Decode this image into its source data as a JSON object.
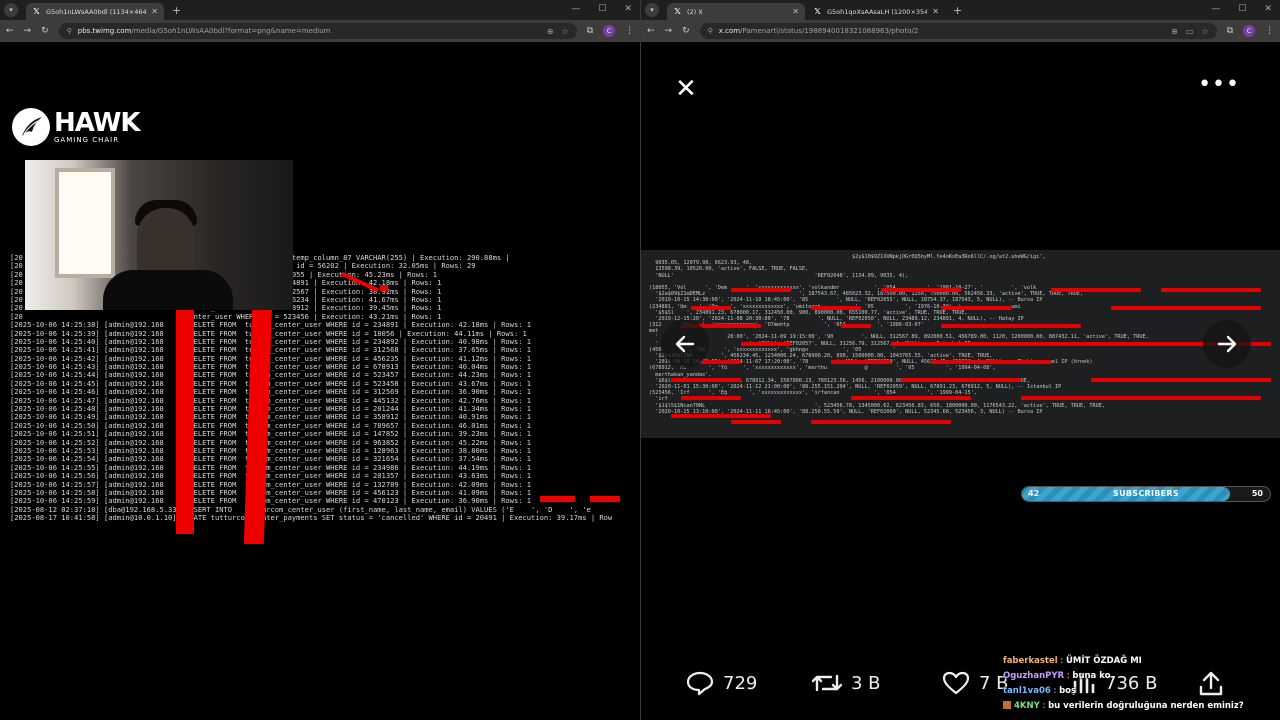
{
  "left_browser": {
    "tab_title": "G5oh1nLWsAA0bdl (1134×464)",
    "url_host": "pbs.twimg.com",
    "url_path": "/media/G5oh1nLWsAA0bdl?format=png&name=medium",
    "profile_initial": "C"
  },
  "right_browser": {
    "tabs": [
      {
        "title": "(2) X",
        "active": true
      },
      {
        "title": "G5oh1qoXsAAsaLH (1200×354)",
        "active": false
      }
    ],
    "url_host": "x.com",
    "url_path": "/Pamenarti/status/1988940018321088963/photo/2",
    "profile_initial": "C"
  },
  "overlay": {
    "brand_name": "HAWK",
    "brand_sub": "GAMING CHAIR"
  },
  "terminal_lines": [
    "[20                                      m_center_user ADD COLUMN temp_column_87 VARCHAR(255) | Execution: 290.88ms |",
    "[20                                      center_transactions WHERE id = 56202 | Execution: 32.05ms | Rows: 29",
    "[20                                      center_user WHERE id = 18055 | Execution: 45.23ms | Rows: 1",
    "[20                                      center_user WHERE id = 234891 | Execution: 42.18ms | Rows: 1",
    "[20                                      center_user WHERE id = 312567 | Execution: 38.92ms | Rows: 1",
    "[20                                      center_user WHERE id = 456234 | Execution: 41.67ms | Rows: 1",
    "[20                                      center_user WHERE id = 678912 | Execution: 39.45ms | Rows: 1",
    "[20                                      center_user WHERE id = 523456 | Execution: 43.21ms | Rows: 1",
    "[2025-10-06 14:25:38] [admin@192.168      DELETE FROM  turcom_center_user WHERE id = 234891 | Execution: 42.18ms | Rows: 1",
    "[2025-10-06 14:25:39] [admin@192.168      DELETE FROM  turcom_center_user WHERE id = 18056 | Execution: 44.11ms | Rows: 1",
    "[2025-10-06 14:25:40] [admin@192.168      DELETE FROM  turcom_center_user WHERE id = 234892 | Execution: 40.98ms | Rows: 1",
    "[2025-10-06 14:25:41] [admin@192.168      DELETE FROM  turcom_center_user WHERE id = 312568 | Execution: 37.65ms | Rows: 1",
    "[2025-10-06 14:25:42] [admin@192.168      DELETE FROM  turcom_center_user WHERE id = 456235 | Execution: 41.12ms | Rows: 1",
    "[2025-10-06 14:25:43] [admin@192.168      DELETE FROM  turcom_center_user WHERE id = 678913 | Execution: 40.04ms | Rows: 1",
    "[2025-10-06 14:25:44] [admin@192.168      DELETE FROM  turcom_center_user WHERE id = 523457 | Execution: 44.23ms | Rows: 1",
    "[2025-10-06 14:25:45] [admin@192.168      DELETE FROM  turcom_center_user WHERE id = 523458 | Execution: 43.67ms | Rows: 1",
    "[2025-10-06 14:25:46] [admin@192.168      DELETE FROM  turcom_center_user WHERE id = 312569 | Execution: 36.90ms | Rows: 1",
    "[2025-10-06 14:25:47] [admin@192.168      DELETE FROM  turcom_center_user WHERE id = 445132 | Execution: 42.76ms | Rows: 1",
    "[2025-10-06 14:25:48] [admin@192.168      DELETE FROM  turcom_center_user WHERE id = 201244 | Execution: 41.34ms | Rows: 1",
    "[2025-10-06 14:25:49] [admin@192.168      DELETE FROM  turcom_center_user WHERE id = 358912 | Execution: 40.91ms | Rows: 1",
    "[2025-10-06 14:25:50] [admin@192.168      DELETE FROM  turcom_center_user WHERE id = 789657 | Execution: 46.01ms | Rows: 1",
    "[2025-10-06 14:25:51] [admin@192.168      DELETE FROM  turcom_center_user WHERE id = 147852 | Execution: 39.23ms | Rows: 1",
    "[2025-10-06 14:25:52] [admin@192.168      DELETE FROM  turcom_center_user WHERE id = 963852 | Execution: 45.22ms | Rows: 1",
    "[2025-10-06 14:25:53] [admin@192.168      DELETE FROM  turcom_center_user WHERE id = 128963 | Execution: 38.80ms | Rows: 1",
    "[2025-10-06 14:25:54] [admin@192.168      DELETE FROM  turcom_center_user WHERE id = 321654 | Execution: 37.54ms | Rows: 1",
    "[2025-10-06 14:25:55] [admin@192.168      DELETE FROM  turcom_center_user WHERE id = 234986 | Execution: 44.19ms | Rows: 1",
    "[2025-10-06 14:25:56] [admin@192.168      DELETE FROM  turcom_center_user WHERE id = 201357 | Execution: 43.63ms | Rows: 1",
    "[2025-10-06 14:25:57] [admin@192.168      DELETE FROM  turcom_center_user WHERE id = 132789 | Execution: 42.09ms | Rows: 1",
    "[2025-10-06 14:25:58] [admin@192.168      DELETE FROM  turcom_center_user WHERE id = 456123 | Execution: 41.09ms | Rows: 1",
    "[2025-10-06 14:25:59] [admin@192.168      DELETE FROM  turcom_center_user WHERE id = 470123 | Execution: 36.90ms | Rows: 1",
    "[2025-08-12 02:37:18] [dba@192.168.5.33] INSERT INTO      turcom_center_user (first_name, last_name, email) VALUES ('E    ', 'D    ', 'e",
    "[2025-08-17 10:41:58] [admin@10.0.1.10] UPDATE tutturcom_center_payments SET status = 'cancelled' WHERE id = 20491 | Execution: 39.17ms | Row"
  ],
  "photo_lines": [
    "                                                                 $2y$10$9Z1XUNpkjOGr0Q5byMl.Ye4oKoEa3Ro6llC/.og/at2.uheWG/igi',",
    "  9035.05, 12079.98, 6623.93, 48,",
    "  13598.39, 10520.00, 'active', FALSE, TRUE, FALSE,",
    "  'NULL'                                             'REF02048', 1134.09, 9035, 4),",
    "",
    "(18055, 'Vol      ', 'Dem      ', 'xxxxxxxxxxxxx', 'volkandmr           ', '054          ', '1981-10-27', '         ', 'volk",
    "  '$2a$09$Z1mDEMLz                              ', 187543.67, 485023.32, 187500.00, 1250, 750000.00, 562456.33, 'active', TRUE, TRUE, TRUE,",
    "  '2019-10-15 14:30:00', '2024-11-10 18:45:00', '85         ', NULL, 'REF02055', NULL, 18754.37, 187543, 5, NULL), -- Bursa IP",
    "(234891, 'Üm    ', 'Öz    ', 'xxxxxxxxxxxxx', 'umitozat           ', '05          ', '1976-10-30', '                umi",
    "  '$5$Sl    ', 234891.23, 678000.17, 312450.00, 980, 890000.00, 655100.77, 'active', TRUE, TRUE, TRUE,",
    "  '2019-12-15:20', '2024-11-08 20:30:00', '78         ', NULL, 'REF02050', NULL, 23489.12, 234891, 4, NULL), -- Hatay IP",
    "(312    , 'Te    ', 'xxxxxxxxxxxxx', 'O7mehtp           ', '054          ', '1986-03-07'",
    "met",
    "  '                      20:00', '2024-11-09 19:15:00', '90         ', NULL, 312567.89, 892000.51, 456789.00, 1120, 1200000.00, 887432.11, 'active', TRUE, TRUE,",
    "  '                             ', 'NULL', 'REF02057', NULL, 31256.79, 312567, 4, NULL), -- Istanbul IP",
    "(456        ', 'Gö      ', 'xxxxxxxxxxxxx', 'gkhngo           ', '05          '",
    "  '$2y$10$l2N4         ', 456234.45, 1234000.24, 678900.20, 890, 1500000.00, 1043765.55, 'active', TRUE, TRUE,",
    "  '2014-09-15 14:20:00', '2024-11-07 17:20:00', '78         ', NULL, 'REF02058', NULL, 45623.45, 456234, 4, NULL), -- Türkiye genel IP (örnek)",
    "(678912, 'Me       ', 'Yü     ', 'xxxxxxxxxxxxx', 'merthu            @         ', '05          ', '1994-04-08',",
    "  merthakan_yandas',",
    "  '$6$l13$navr345J          ', 678912.34, 1567000.23, 789123.56, 1450, 2100000.00, 1321087.66, 'active', TRUE, TRUE, TRUE,",
    "  '2020-11-01 15:30:00', '2024-11-12 21:00:00', '88.255.151.204', NULL, 'REF02059', NULL, 67891.23, 678912, 5, NULL), -- Istanbul IP",
    "(523456, 'İrf      ', 'Eğ       ', 'xxxxxxxxxxxxx', 'irfancan           ', '054          ', '1999-04-15',",
    "  'irf      ',",
    "  '$1$l5$1Ncan70NL                                   ', 523456.78, 1345000.62, 623456.83, 650, 1800000.00, 1176543.22, 'active', TRUE, TRUE, TRUE,",
    "  '2020-10-25 13:10:00', '2024-11-11 16:45:00', '88.250.55.59', NULL, 'REF02060', NULL, 52345.68, 523456, 3, NULL) -- Bursa IP"
  ],
  "subscribers": {
    "current": "42",
    "label": "SUBSCRIBERS",
    "goal": "50",
    "fraction": 0.84
  },
  "actions": {
    "replies": "729",
    "reposts": "3 B",
    "likes": "7 B",
    "views": "736 B"
  },
  "chat": [
    {
      "user": "faberkastel",
      "text": "ÜMİT ÖZDAĞ MI"
    },
    {
      "user": "OguzhanPYR",
      "text": "buna ko"
    },
    {
      "user": "tanl1va06",
      "text": "boş"
    },
    {
      "user": "4KNY",
      "text": "bu verilerin doğruluğuna nerden eminiz?"
    }
  ],
  "colors": {
    "redaction": "#e00000",
    "terminal_ip": "#c96bd4",
    "subscriber_bar": "#3aa5cf"
  }
}
